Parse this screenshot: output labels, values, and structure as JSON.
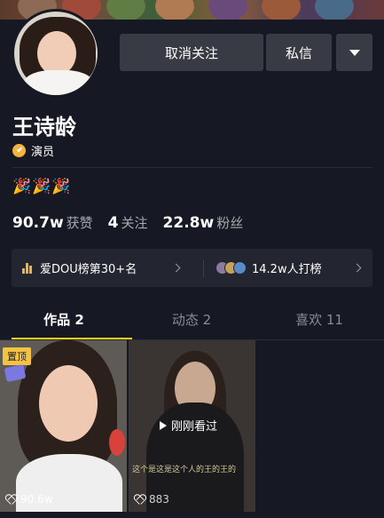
{
  "profile": {
    "name": "王诗龄",
    "verify_label": "演员",
    "emojis": "🎉🎉🎉"
  },
  "actions": {
    "unfollow_label": "取消关注",
    "message_label": "私信",
    "more_icon": "triangle-down-icon"
  },
  "stats": {
    "likes_value": "90.7w",
    "likes_label": "获赞",
    "following_value": "4",
    "following_label": "关注",
    "followers_value": "22.8w",
    "followers_label": "粉丝"
  },
  "ranking": {
    "left_label": "爱DOU榜第30+名",
    "right_label": "14.2w人打榜"
  },
  "tabs": [
    {
      "label": "作品 2",
      "active": true
    },
    {
      "label": "动态 2",
      "active": false
    },
    {
      "label": "喜欢 11",
      "active": false
    }
  ],
  "videos": [
    {
      "pinned_label": "置顶",
      "likes": "90.6w"
    },
    {
      "watched_label": "刚刚看过",
      "caption": "这个是这是这个人的王的王的",
      "likes": "883"
    }
  ],
  "colors": {
    "background": "#161823",
    "button": "#393b44",
    "accent_tab": "#face15",
    "verify": "#f5b33e",
    "pin": "#f5c342"
  }
}
